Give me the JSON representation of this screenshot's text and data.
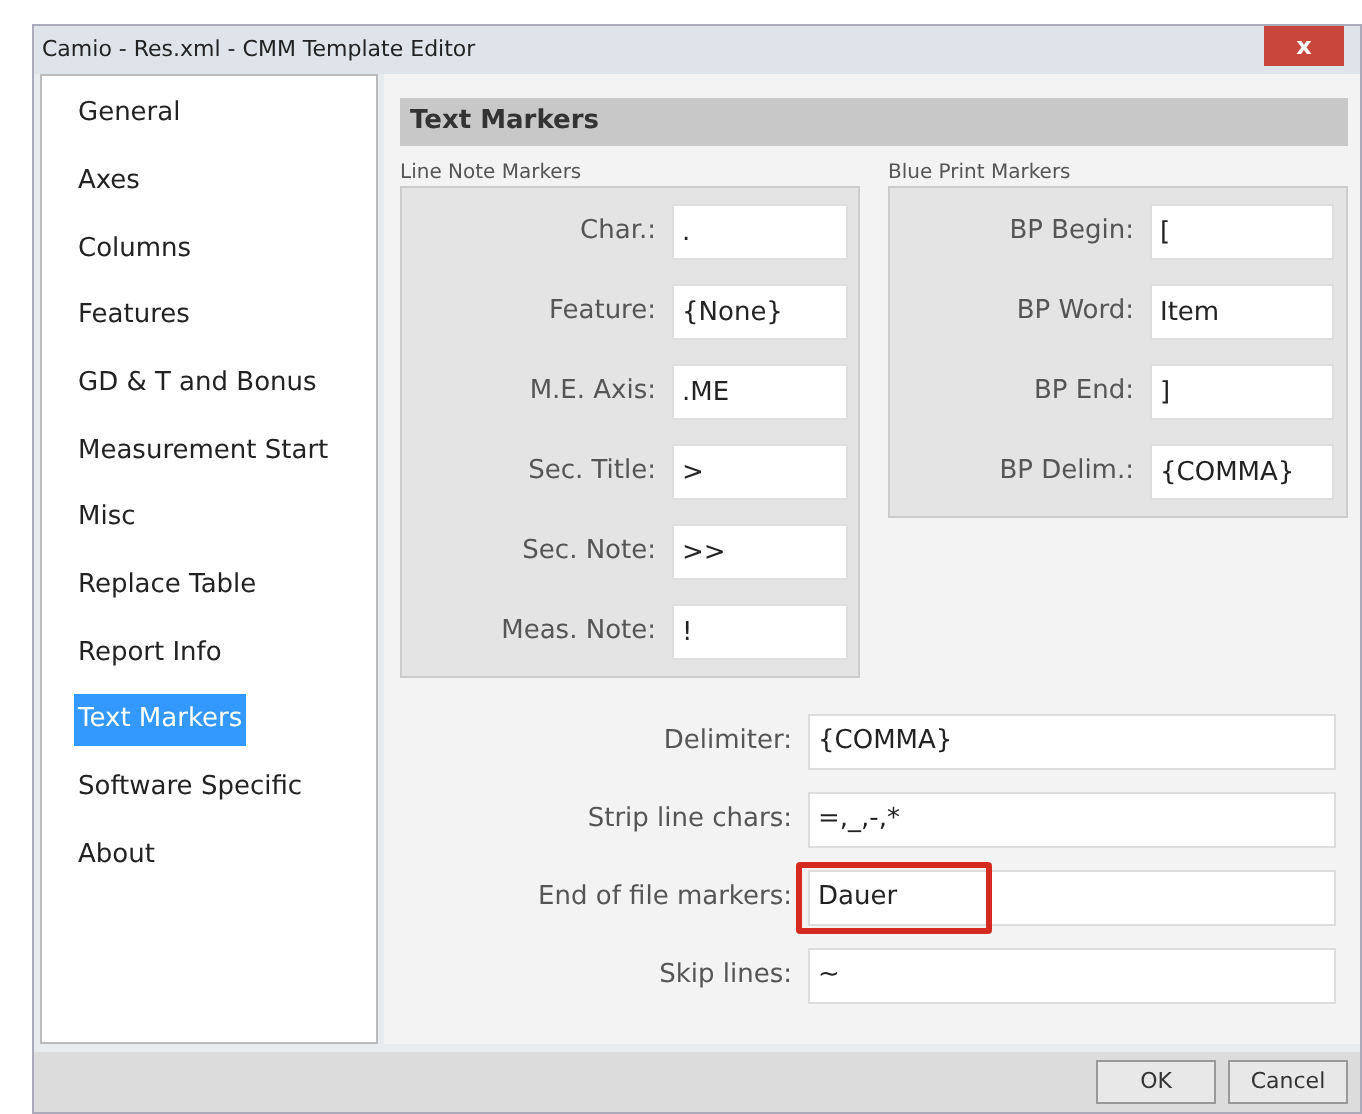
{
  "window": {
    "title": "Camio - Res.xml - CMM Template Editor",
    "close": "x"
  },
  "sidebar": {
    "items": [
      {
        "label": "General",
        "selected": false
      },
      {
        "label": "Axes",
        "selected": false
      },
      {
        "label": "Columns",
        "selected": false
      },
      {
        "label": "Features",
        "selected": false
      },
      {
        "label": "GD & T and Bonus",
        "selected": false
      },
      {
        "label": "Measurement Start",
        "selected": false
      },
      {
        "label": "Misc",
        "selected": false
      },
      {
        "label": "Replace Table",
        "selected": false
      },
      {
        "label": "Report Info",
        "selected": false
      },
      {
        "label": "Text Markers",
        "selected": true
      },
      {
        "label": "Software Specific",
        "selected": false
      },
      {
        "label": "About",
        "selected": false
      }
    ]
  },
  "panel": {
    "title": "Text Markers",
    "line_note_markers": {
      "title": "Line Note Markers",
      "fields": [
        {
          "label": "Char.:",
          "value": "."
        },
        {
          "label": "Feature:",
          "value": "{None}"
        },
        {
          "label": "M.E. Axis:",
          "value": ".ME"
        },
        {
          "label": "Sec. Title:",
          "value": ">"
        },
        {
          "label": "Sec. Note:",
          "value": ">>"
        },
        {
          "label": "Meas. Note:",
          "value": "!"
        }
      ]
    },
    "blue_print_markers": {
      "title": "Blue Print Markers",
      "fields": [
        {
          "label": "BP Begin:",
          "value": "["
        },
        {
          "label": "BP Word:",
          "value": "Item"
        },
        {
          "label": "BP End:",
          "value": "]"
        },
        {
          "label": "BP Delim.:",
          "value": "{COMMA}"
        }
      ]
    },
    "fields": [
      {
        "label": "Delimiter:",
        "value": "{COMMA}",
        "highlighted": false
      },
      {
        "label": "Strip line chars:",
        "value": "=,_,-,*",
        "highlighted": false
      },
      {
        "label": "End of file markers:",
        "value": "Dauer",
        "highlighted": true
      },
      {
        "label": "Skip lines:",
        "value": "~",
        "highlighted": false
      }
    ]
  },
  "buttons": [
    "OK",
    "Cancel"
  ]
}
